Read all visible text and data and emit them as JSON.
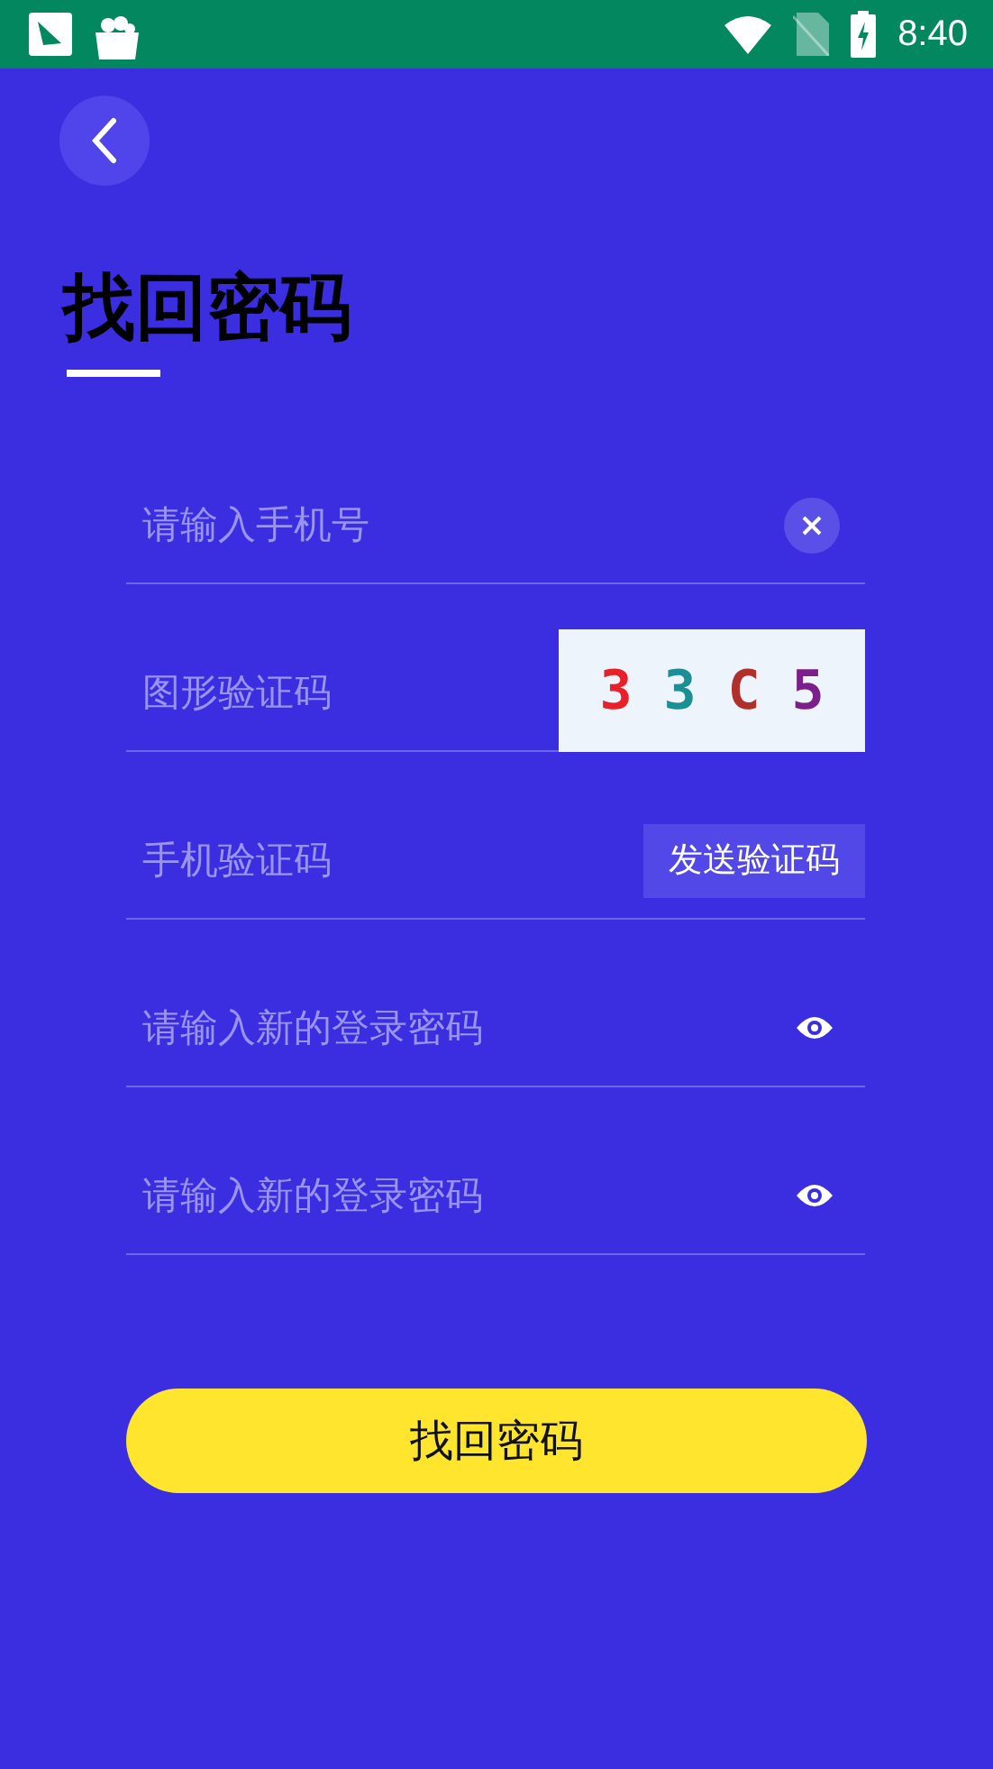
{
  "status_bar": {
    "time": "8:40"
  },
  "title": "找回密码",
  "fields": [
    {
      "kind": "clear",
      "placeholder": "请输入手机号"
    },
    {
      "kind": "captcha",
      "placeholder": "图形验证码",
      "captcha": [
        {
          "char": "3",
          "color": "#e8202a"
        },
        {
          "char": "3",
          "color": "#1a8f95"
        },
        {
          "char": "C",
          "color": "#b0302a"
        },
        {
          "char": "5",
          "color": "#7a1f8c"
        }
      ]
    },
    {
      "kind": "sms",
      "placeholder": "手机验证码",
      "button": "发送验证码"
    },
    {
      "kind": "password",
      "placeholder": "请输入新的登录密码"
    },
    {
      "kind": "password",
      "placeholder": "请输入新的登录密码"
    }
  ],
  "submit": "找回密码"
}
